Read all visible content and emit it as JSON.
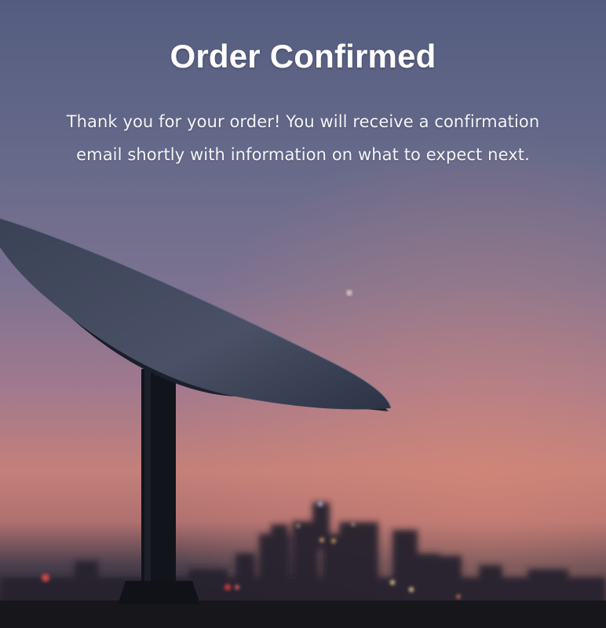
{
  "page": {
    "title": "Order Confirmed",
    "message": "Thank you for your order! You will receive a confirmation email shortly with information on what to expect next."
  },
  "background": {
    "description_icon": "starlink-dish-sunset-image",
    "colors": {
      "sky_top": "#5a6384",
      "sky_mid": "#8a7590",
      "sky_glow": "#c98079",
      "horizon": "#3a3240",
      "dish": "#1c2230",
      "text": "#ffffff"
    }
  }
}
